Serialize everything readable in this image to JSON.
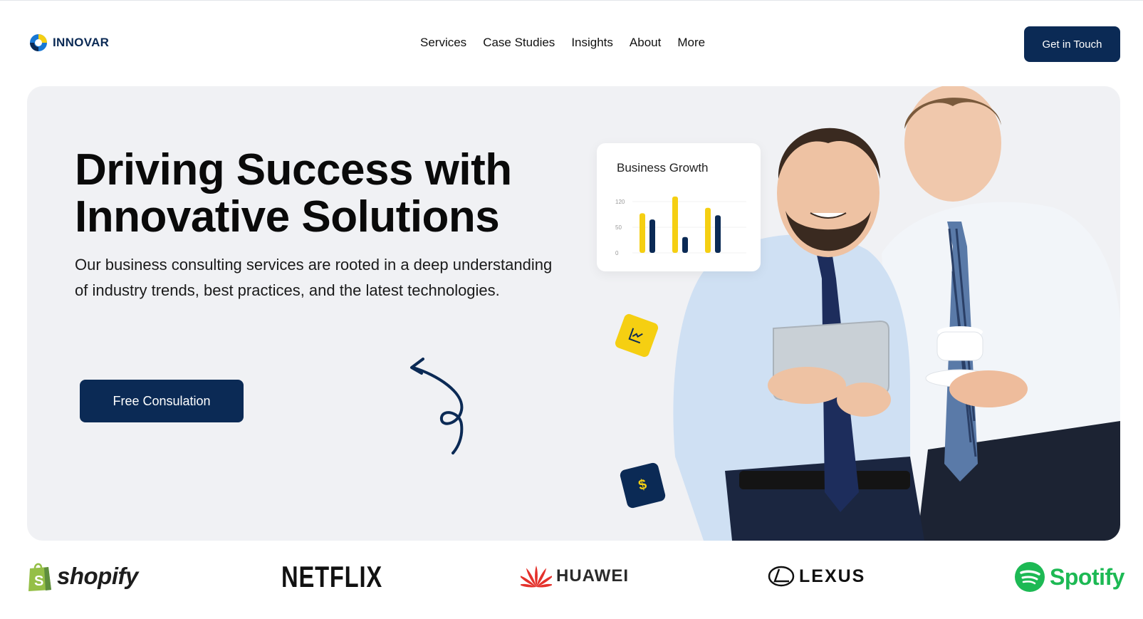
{
  "brand": {
    "name": "INNOVAR"
  },
  "nav": {
    "items": [
      "Services",
      "Case Studies",
      "Insights",
      "About",
      "More"
    ],
    "cta_label": "Get in Touch"
  },
  "hero": {
    "headline_line1": "Driving Success with",
    "headline_line2": "Innovative Solutions",
    "subtext": "Our business consulting services are rooted in a deep understanding of industry trends, best practices, and the latest technologies.",
    "button_label": "Free Consulation",
    "growth_card": {
      "title": "Business Growth",
      "chart_data": {
        "type": "bar",
        "yticks": [
          "120",
          "50",
          "0"
        ],
        "series": [
          {
            "color": "#f5cf12",
            "values": [
              95,
              135,
              108
            ]
          },
          {
            "color": "#0b2a55",
            "values": [
              80,
              38,
              90
            ]
          }
        ]
      }
    },
    "badge_dollar": "$"
  },
  "logos": {
    "shopify": "shopify",
    "netflix": "NETFLIX",
    "huawei": "HUAWEI",
    "lexus": "LEXUS",
    "spotify": "Spotify"
  },
  "colors": {
    "navy": "#0b2a55",
    "yellow": "#f5cf12",
    "hero_bg": "#f0f1f4",
    "spotify_green": "#1db954",
    "shopify_green": "#95bf47",
    "huawei_red": "#e4312b"
  }
}
